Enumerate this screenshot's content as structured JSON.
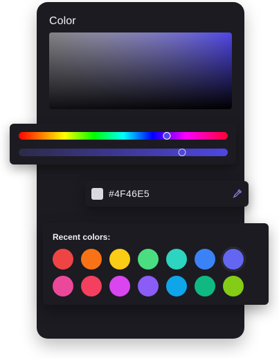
{
  "picker": {
    "title": "Color",
    "selected_color": "#4F46E5",
    "hue_fraction": 0.71,
    "alpha_fraction": 0.78
  },
  "hex_input": {
    "value": "#4F46E5",
    "swatch_color": "#D9D9DE",
    "eyedropper_icon": "eyedropper-icon",
    "icon_color": "#8B85F0"
  },
  "recent": {
    "label": "Recent colors:",
    "rows": [
      [
        "#EF4444",
        "#F97316",
        "#FACC15",
        "#4ADE80",
        "#2DD4BF",
        "#3B82F6",
        "#6366F1"
      ],
      [
        "#EC4899",
        "#F43F5E",
        "#D946EF",
        "#8B5CF6",
        "#0EA5E9",
        "#10B981",
        "#84CC16"
      ]
    ],
    "selected_index": 6
  }
}
